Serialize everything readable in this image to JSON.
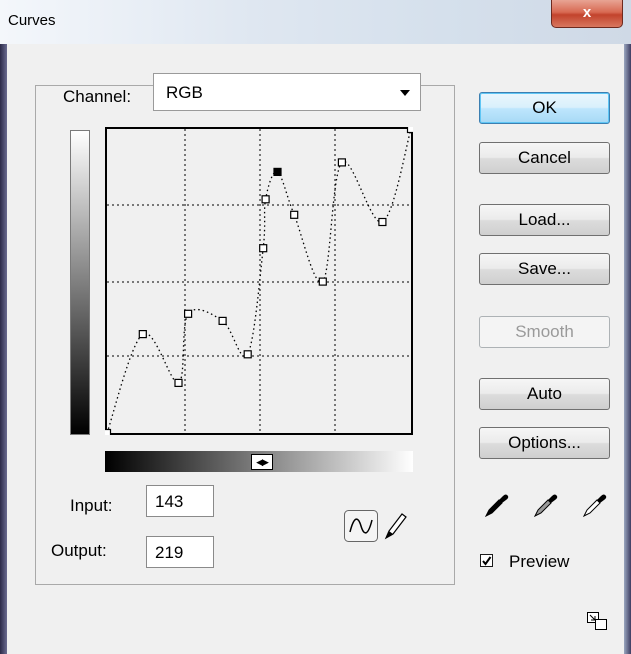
{
  "window": {
    "title": "Curves",
    "close_label": "x"
  },
  "channel": {
    "label": "Channel:",
    "value": "RGB"
  },
  "input": {
    "label": "Input:",
    "value": "143"
  },
  "output": {
    "label": "Output:",
    "value": "219"
  },
  "buttons": {
    "ok": "OK",
    "cancel": "Cancel",
    "load": "Load...",
    "save": "Save...",
    "smooth": "Smooth",
    "auto": "Auto",
    "options": "Options..."
  },
  "preview": {
    "label": "Preview",
    "checked": true
  },
  "tools": {
    "curve_tool": "curve-icon",
    "pencil_tool": "pencil-icon",
    "eyedroppers": [
      "black-eyedropper-icon",
      "gray-eyedropper-icon",
      "white-eyedropper-icon"
    ],
    "expand": "expand-icon"
  },
  "curve_points": [
    {
      "input": 0,
      "output": 0
    },
    {
      "input": 30,
      "output": 83
    },
    {
      "input": 60,
      "output": 42
    },
    {
      "input": 68,
      "output": 100
    },
    {
      "input": 97,
      "output": 94
    },
    {
      "input": 118,
      "output": 66
    },
    {
      "input": 131,
      "output": 155
    },
    {
      "input": 133,
      "output": 196
    },
    {
      "input": 143,
      "output": 219
    },
    {
      "input": 157,
      "output": 183
    },
    {
      "input": 181,
      "output": 127
    },
    {
      "input": 197,
      "output": 227
    },
    {
      "input": 231,
      "output": 177
    },
    {
      "input": 255,
      "output": 255
    }
  ],
  "selected_point_index": 8
}
